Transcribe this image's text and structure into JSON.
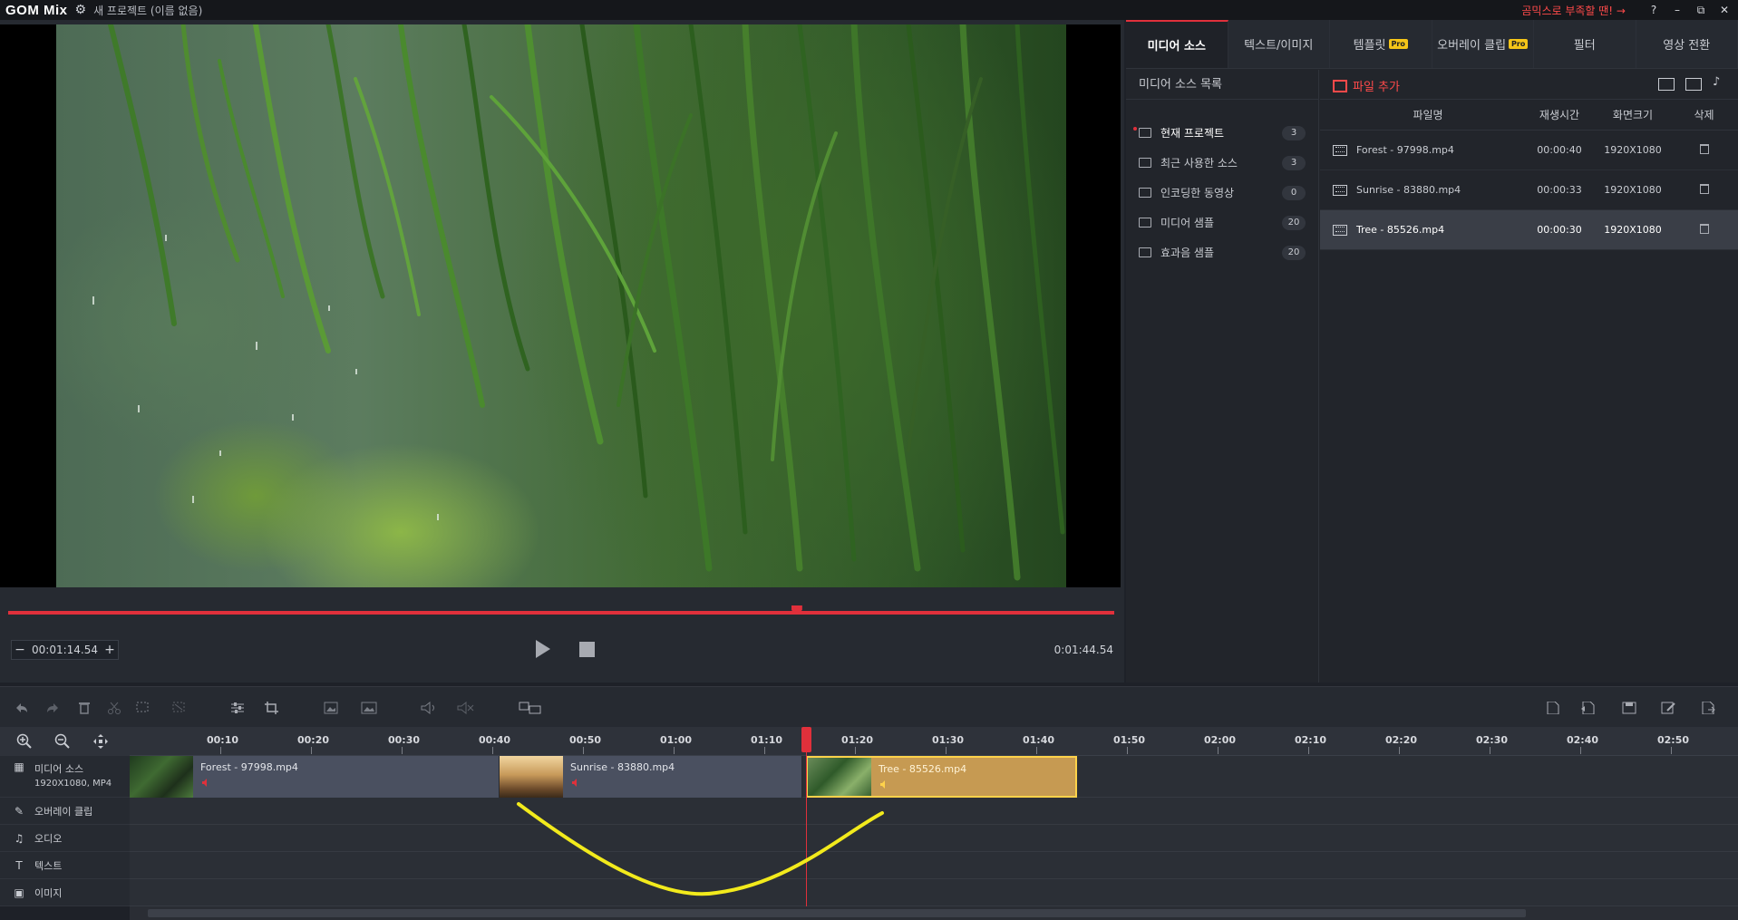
{
  "app": {
    "logo": "GOM Mix",
    "project_title": "새 프로젝트 (이름 없음)",
    "promo": "곰믹스로 부족할 땐! →",
    "help": "?",
    "minimize": "–",
    "restore": "⧉",
    "close": "✕"
  },
  "preview": {
    "current_time": "00:01:14.54",
    "total_time": "0:01:44.54",
    "minus": "−",
    "plus": "+",
    "progress": 0.713
  },
  "panel": {
    "tabs": [
      {
        "label": "미디어 소스",
        "active": true
      },
      {
        "label": "텍스트/이미지",
        "active": false
      },
      {
        "label": "템플릿",
        "pro": "Pro",
        "active": false
      },
      {
        "label": "오버레이 클립",
        "pro": "Pro",
        "active": false
      },
      {
        "label": "필터",
        "active": false
      },
      {
        "label": "영상 전환",
        "active": false
      }
    ],
    "source_list_title": "미디어 소스 목록",
    "sources": [
      {
        "label": "현재 프로젝트",
        "count": "3",
        "active": true
      },
      {
        "label": "최근 사용한 소스",
        "count": "3",
        "active": false
      },
      {
        "label": "인코딩한 동영상",
        "count": "0",
        "active": false
      },
      {
        "label": "미디어 샘플",
        "count": "20",
        "active": false
      },
      {
        "label": "효과음 샘플",
        "count": "20",
        "active": false
      }
    ],
    "add_file": "파일 추가",
    "columns": {
      "name": "파일명",
      "duration": "재생시간",
      "resolution": "화면크기",
      "delete": "삭제"
    },
    "files": [
      {
        "name": "Forest - 97998.mp4",
        "duration": "00:00:40",
        "resolution": "1920X1080",
        "selected": false
      },
      {
        "name": "Sunrise - 83880.mp4",
        "duration": "00:00:33",
        "resolution": "1920X1080",
        "selected": false
      },
      {
        "name": "Tree - 85526.mp4",
        "duration": "00:00:30",
        "resolution": "1920X1080",
        "selected": true
      }
    ]
  },
  "timeline": {
    "ruler": [
      "00:10",
      "00:20",
      "00:30",
      "00:40",
      "00:50",
      "01:00",
      "01:10",
      "01:20",
      "01:30",
      "01:40",
      "01:50",
      "02:00",
      "02:10",
      "02:20",
      "02:30",
      "02:40",
      "02:50"
    ],
    "tracks": {
      "media": "미디어 소스",
      "media_info": "1920X1080, MP4",
      "overlay": "오버레이 클립",
      "audio": "오디오",
      "text": "텍스트",
      "image": "이미지"
    },
    "clips": [
      {
        "name": "Forest - 97998.mp4"
      },
      {
        "name": "Sunrise - 83880.mp4"
      },
      {
        "name": "Tree - 85526.mp4"
      }
    ]
  },
  "colors": {
    "accent": "#e0303b",
    "selected_clip": "#c69a52",
    "annotation": "#f2ea1c"
  }
}
